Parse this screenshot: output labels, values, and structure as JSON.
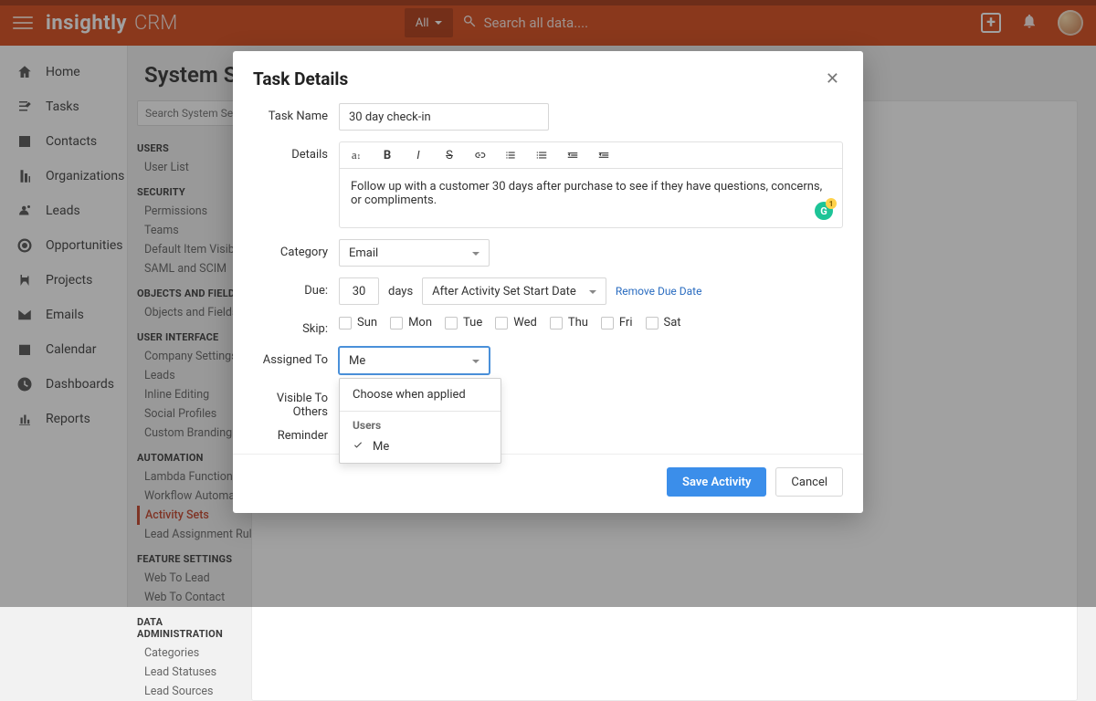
{
  "top": {
    "brand_main": "insightly",
    "brand_sub": "CRM",
    "all_button": "All",
    "search_placeholder": "Search all data...."
  },
  "nav": {
    "items": [
      {
        "label": "Home",
        "icon": "home"
      },
      {
        "label": "Tasks",
        "icon": "tasks"
      },
      {
        "label": "Contacts",
        "icon": "contacts"
      },
      {
        "label": "Organizations",
        "icon": "org"
      },
      {
        "label": "Leads",
        "icon": "leads"
      },
      {
        "label": "Opportunities",
        "icon": "target"
      },
      {
        "label": "Projects",
        "icon": "projects"
      },
      {
        "label": "Emails",
        "icon": "mail"
      },
      {
        "label": "Calendar",
        "icon": "calendar"
      },
      {
        "label": "Dashboards",
        "icon": "clock"
      },
      {
        "label": "Reports",
        "icon": "reports"
      }
    ]
  },
  "page": {
    "title": "System Settings",
    "title_visible": "System Setti",
    "search_placeholder": "Search System Settin"
  },
  "settings_groups": [
    {
      "head": "USERS",
      "items": [
        "User List"
      ]
    },
    {
      "head": "SECURITY",
      "items": [
        "Permissions",
        "Teams",
        "Default Item Visibility",
        "SAML and SCIM"
      ]
    },
    {
      "head": "OBJECTS AND FIELDS",
      "items": [
        "Objects and Fields"
      ]
    },
    {
      "head": "USER INTERFACE",
      "items": [
        "Company Settings",
        "Leads",
        "Inline Editing",
        "Social Profiles",
        "Custom Branding"
      ]
    },
    {
      "head": "AUTOMATION",
      "items": [
        "Lambda Functions",
        "Workflow Automation",
        "Activity Sets",
        "Lead Assignment Rules"
      ],
      "active_index": 2
    },
    {
      "head": "FEATURE SETTINGS",
      "items": [
        "Web To Lead",
        "Web To Contact"
      ]
    },
    {
      "head": "DATA ADMINISTRATION",
      "items": [
        "Categories",
        "Lead Statuses",
        "Lead Sources"
      ]
    }
  ],
  "modal": {
    "title": "Task Details",
    "labels": {
      "task_name": "Task Name",
      "details": "Details",
      "category": "Category",
      "due": "Due:",
      "skip": "Skip:",
      "assigned_to": "Assigned To",
      "visible": "Visible To Others",
      "reminder": "Reminder"
    },
    "task_name_value": "30 day check-in",
    "details_text": "Follow up with a customer 30 days after purchase to see if they have questions, concerns, or compliments.",
    "category_value": "Email",
    "due_number": "30",
    "due_unit": "days",
    "due_relation": "After Activity Set Start Date",
    "remove_due": "Remove Due Date",
    "skip_days": [
      "Sun",
      "Mon",
      "Tue",
      "Wed",
      "Thu",
      "Fri",
      "Sat"
    ],
    "assigned_value": "Me",
    "dropdown": {
      "option_choose": "Choose when applied",
      "group_label": "Users",
      "option_me": "Me"
    },
    "save": "Save Activity",
    "cancel": "Cancel"
  }
}
